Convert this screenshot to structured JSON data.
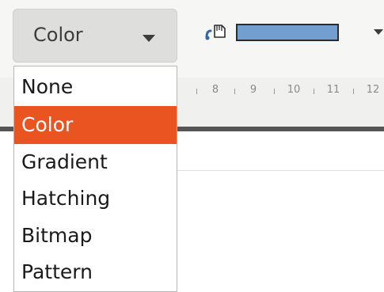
{
  "fill_type_select": {
    "value": "Color",
    "options": [
      "None",
      "Color",
      "Gradient",
      "Hatching",
      "Bitmap",
      "Pattern"
    ],
    "selected_index": 1
  },
  "fill_color": {
    "color": "#729fcf",
    "icon": "paint-bucket-icon"
  },
  "ruler": {
    "labels": [
      "8",
      "9",
      "10",
      "11",
      "12"
    ]
  },
  "colors": {
    "accent": "#e95420",
    "fill_color": "#729fcf"
  }
}
